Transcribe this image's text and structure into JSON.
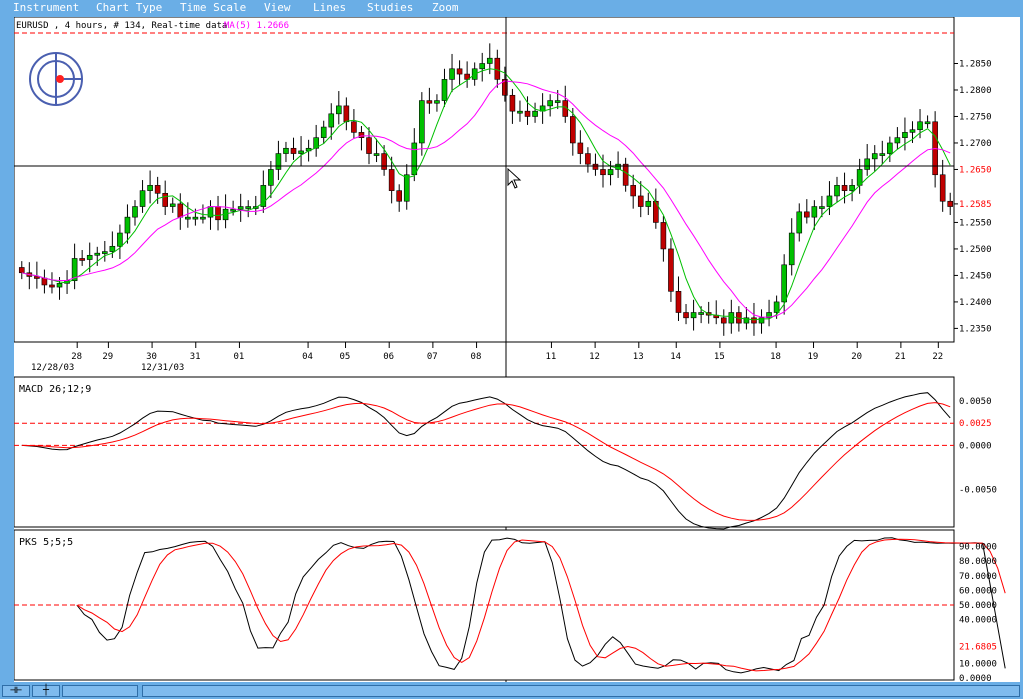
{
  "menu": {
    "items": [
      "Instrument",
      "Chart Type",
      "Time Scale",
      "View",
      "Lines",
      "Studies",
      "Zoom"
    ]
  },
  "header": {
    "symbol_info": "EURUSD , 4 hours, # 134, Real-time data",
    "ma_info": "MA(5) 1.2666",
    "ma_info_color": "#ff00ff"
  },
  "price_axis": {
    "labels": [
      "1.2850",
      "1.2800",
      "1.2750",
      "1.2700",
      "1.2650",
      "1.2585",
      "1.2550",
      "1.2500",
      "1.2450",
      "1.2400",
      "1.2350"
    ],
    "highlight_labels": [
      "1.2650",
      "1.2585"
    ],
    "highlight_color": "#ff0000"
  },
  "date_axis": {
    "labels": [
      "28",
      "29",
      "30",
      "31",
      "01",
      "04",
      "05",
      "06",
      "07",
      "08",
      "11",
      "12",
      "13",
      "14",
      "15",
      "18",
      "19",
      "20",
      "21",
      "22"
    ],
    "sub_labels": [
      "12/28/03",
      "12/31/03"
    ]
  },
  "macd_panel": {
    "title": "MACD 26;12;9",
    "axis_labels": [
      "0.0050",
      "0.0025",
      "0.0000",
      "-0.0050"
    ],
    "highlight_label": "0.0025"
  },
  "pks_panel": {
    "title": "PKS 5;5;5",
    "axis_labels": [
      "90.0000",
      "80.0000",
      "70.0000",
      "60.0000",
      "50.0000",
      "40.0000",
      "21.6805",
      "10.0000",
      "0.0000"
    ],
    "highlight_label": "21.6805"
  },
  "colors": {
    "bull_candle": "#00c000",
    "bear_candle": "#c00000",
    "ma_fast": "#00c000",
    "ma_slow": "#ff00ff",
    "signal_line": "#ff0000",
    "indicator_line": "#000000",
    "window_bg": "#6aaee6"
  },
  "chart_data": [
    {
      "type": "candlestick",
      "title": "EURUSD , 4 hours, # 134, Real-time data",
      "ylim": [
        1.233,
        1.29
      ],
      "closes": [
        1.2455,
        1.2448,
        1.2445,
        1.2432,
        1.2428,
        1.2435,
        1.244,
        1.2482,
        1.248,
        1.2488,
        1.2492,
        1.2495,
        1.2505,
        1.253,
        1.256,
        1.258,
        1.261,
        1.262,
        1.2605,
        1.258,
        1.2585,
        1.256,
        1.256,
        1.256,
        1.256,
        1.258,
        1.2555,
        1.2575,
        1.2575,
        1.258,
        1.258,
        1.258,
        1.262,
        1.265,
        1.268,
        1.269,
        1.268,
        1.2685,
        1.269,
        1.271,
        1.273,
        1.2755,
        1.277,
        1.274,
        1.272,
        1.271,
        1.268,
        1.268,
        1.265,
        1.261,
        1.259,
        1.264,
        1.27,
        1.278,
        1.2775,
        1.278,
        1.282,
        1.284,
        1.283,
        1.282,
        1.284,
        1.285,
        1.286,
        1.282,
        1.279,
        1.276,
        1.276,
        1.275,
        1.276,
        1.277,
        1.278,
        1.278,
        1.275,
        1.27,
        1.268,
        1.266,
        1.265,
        1.264,
        1.265,
        1.266,
        1.262,
        1.26,
        1.258,
        1.259,
        1.255,
        1.25,
        1.242,
        1.238,
        1.237,
        1.238,
        1.238,
        1.2375,
        1.237,
        1.236,
        1.238,
        1.236,
        1.237,
        1.236,
        1.237,
        1.238,
        1.24,
        1.247,
        1.253,
        1.257,
        1.256,
        1.258,
        1.258,
        1.26,
        1.262,
        1.261,
        1.262,
        1.265,
        1.267,
        1.268,
        1.268,
        1.27,
        1.271,
        1.272,
        1.2725,
        1.274,
        1.274,
        1.264,
        1.259,
        1.258
      ]
    },
    {
      "type": "line",
      "title": "MACD 26;12;9",
      "ylim": [
        -0.009,
        0.0075
      ]
    },
    {
      "type": "line",
      "title": "PKS 5;5;5",
      "ylim": [
        0,
        100
      ]
    }
  ]
}
